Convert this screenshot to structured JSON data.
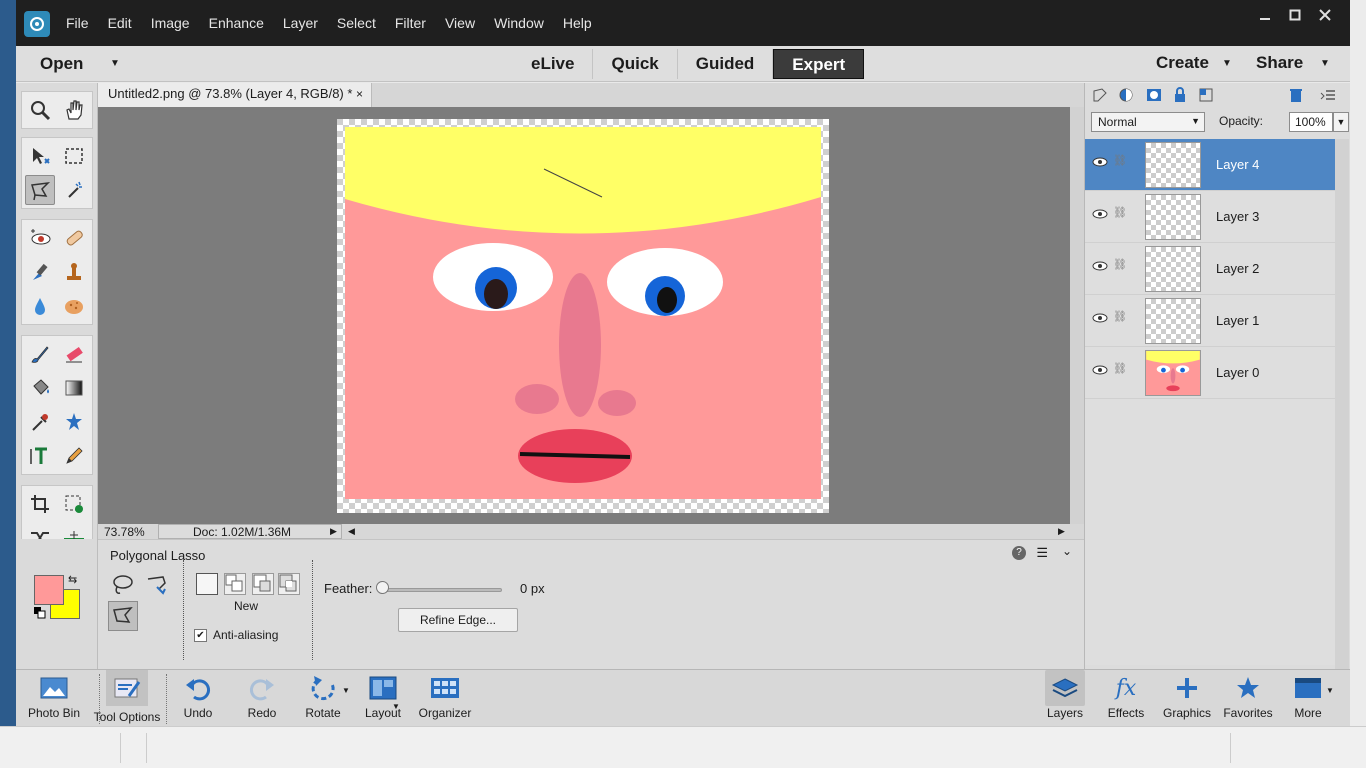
{
  "menu": [
    "File",
    "Edit",
    "Image",
    "Enhance",
    "Layer",
    "Select",
    "Filter",
    "View",
    "Window",
    "Help"
  ],
  "modebar": {
    "open": "Open",
    "tabs": [
      {
        "label": "eLive",
        "active": false
      },
      {
        "label": "Quick",
        "active": false
      },
      {
        "label": "Guided",
        "active": false
      },
      {
        "label": "Expert",
        "active": true
      }
    ],
    "create": "Create",
    "share": "Share"
  },
  "document": {
    "tab_title": "Untitled2.png @ 73.8% (Layer 4, RGB/8) *",
    "close": "×"
  },
  "status": {
    "zoom": "73.78%",
    "doc": "Doc: 1.02M/1.36M"
  },
  "tool_options": {
    "title": "Polygonal Lasso",
    "new_label": "New",
    "anti_aliasing": "Anti-aliasing",
    "anti_aliasing_checked": true,
    "feather_label": "Feather:",
    "feather_value": "0 px",
    "refine_edge": "Refine Edge..."
  },
  "colors": {
    "foreground": "#ff9999",
    "background": "#ffff00"
  },
  "layers": {
    "blend_mode": "Normal",
    "opacity_label": "Opacity:",
    "opacity_value": "100%",
    "items": [
      {
        "name": "Layer 4",
        "active": true
      },
      {
        "name": "Layer 3",
        "active": false
      },
      {
        "name": "Layer 2",
        "active": false
      },
      {
        "name": "Layer 1",
        "active": false
      },
      {
        "name": "Layer 0",
        "active": false
      }
    ]
  },
  "bottombar": {
    "photo_bin": "Photo Bin",
    "tool_options": "Tool Options",
    "undo": "Undo",
    "redo": "Redo",
    "rotate": "Rotate",
    "layout": "Layout",
    "organizer": "Organizer",
    "layers": "Layers",
    "effects": "Effects",
    "graphics": "Graphics",
    "favorites": "Favorites",
    "more": "More"
  }
}
